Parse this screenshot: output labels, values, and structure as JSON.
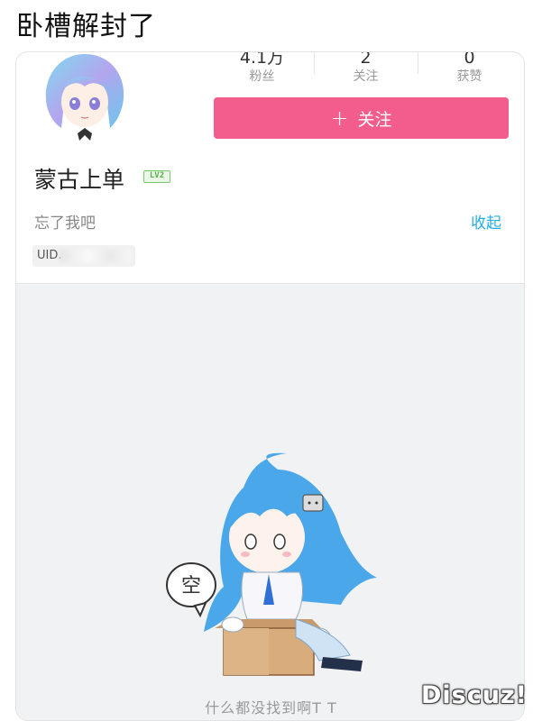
{
  "post": {
    "title": "卧槽解封了"
  },
  "profile": {
    "stats": [
      {
        "value": "4.1万",
        "label": "粉丝"
      },
      {
        "value": "2",
        "label": "关注"
      },
      {
        "value": "0",
        "label": "获赞"
      }
    ],
    "follow_button": {
      "icon": "+",
      "label": "关注"
    },
    "username": "蒙古上单",
    "level": "LV2",
    "signature": "忘了我吧",
    "collapse_label": "收起",
    "uid_label": "UID."
  },
  "content": {
    "empty_bubble": "空",
    "empty_text": "什么都没找到啊T T"
  },
  "watermark": "Discuz!",
  "colors": {
    "follow_button": "#f25d8e",
    "link_blue": "#23ade5",
    "level_badge": "#7bc870",
    "content_bg": "#f1f2f4"
  }
}
